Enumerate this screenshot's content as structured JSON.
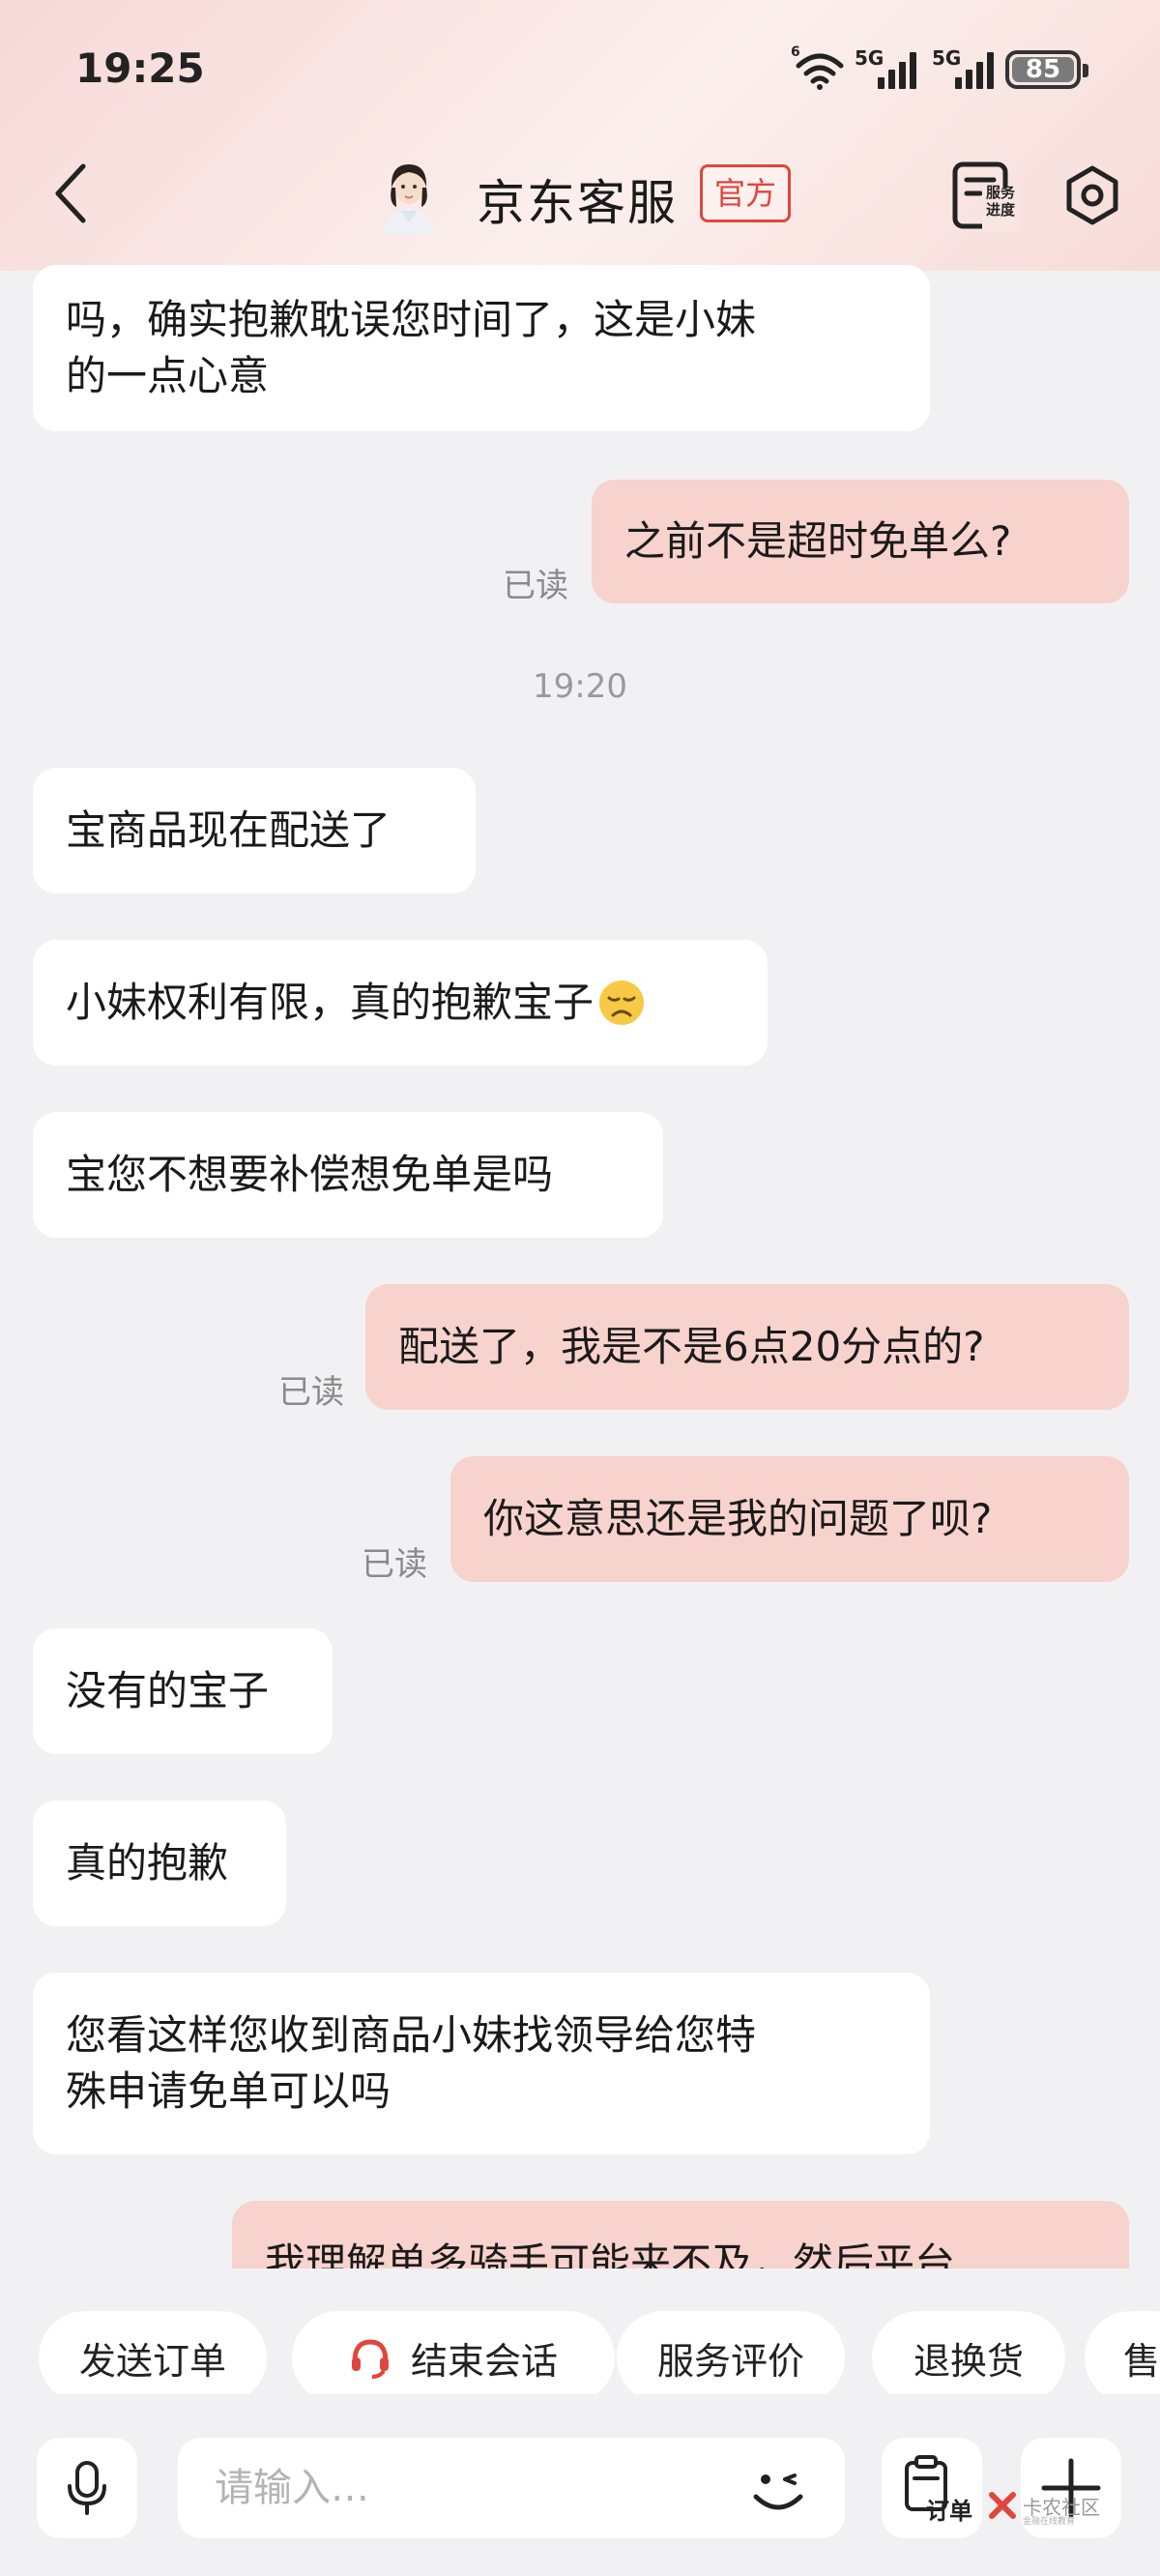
{
  "status_bar": {
    "time": "19:25",
    "wifi_label": "6",
    "signal_1_label": "5G",
    "signal_2_label": "5G",
    "battery": "85"
  },
  "header": {
    "title": "京东客服",
    "badge": "官方",
    "service_progress_label": "服务进度",
    "service_progress_line1": "服务",
    "service_progress_line2": "进度"
  },
  "messages": [
    {
      "side": "in",
      "text_line1": "吗，确实抱歉耽误您时间了，这是小妹",
      "text_line2": "的一点心意"
    },
    {
      "side": "out",
      "text": "之前不是超时免单么?",
      "read": "已读"
    },
    {
      "timestamp": "19:20"
    },
    {
      "side": "in",
      "text": "宝商品现在配送了"
    },
    {
      "side": "in",
      "text": "小妹权利有限，真的抱歉宝子",
      "emoji": "disappointed-face"
    },
    {
      "side": "in",
      "text": "宝您不想要补偿想免单是吗"
    },
    {
      "side": "out",
      "text": "配送了，我是不是6点20分点的?",
      "read": "已读"
    },
    {
      "side": "out",
      "text": "你这意思还是我的问题了呗?",
      "read": "已读"
    },
    {
      "side": "in",
      "text": "没有的宝子"
    },
    {
      "side": "in",
      "text": "真的抱歉"
    },
    {
      "side": "in",
      "text_line1": "您看这样您收到商品小妹找领导给您特",
      "text_line2": "殊申请免单可以吗"
    },
    {
      "side": "out",
      "text": "我理解单多骑手可能来不及，然后平台"
    }
  ],
  "quick_actions": [
    "发送订单",
    "结束会话",
    "服务评价",
    "退换货",
    "售"
  ],
  "input": {
    "placeholder": "请输入…",
    "order_label": "订单"
  },
  "watermark": {
    "text": "卡农社区",
    "sub": "金融在线教育"
  }
}
